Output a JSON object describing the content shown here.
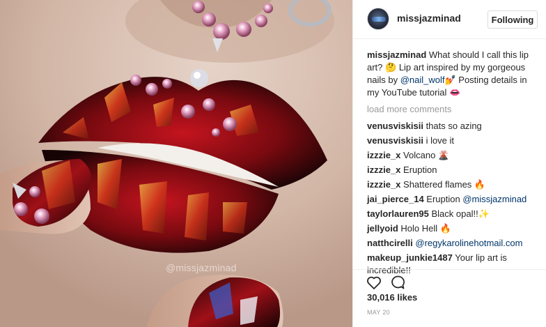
{
  "photo": {
    "watermark": "@missjazminad"
  },
  "header": {
    "username": "missjazminad",
    "follow_label": "Following"
  },
  "caption": {
    "username": "missjazminad",
    "text_1": " What should I call this lip art? ",
    "emoji_1": "🤔",
    "text_2": " Lip art inspired by my gorgeous nails by ",
    "mention": "@nail_wolf",
    "emoji_2": " 💅",
    "text_3": " Posting details in my YouTube tutorial ",
    "emoji_3": "👄"
  },
  "load_more": "load more comments",
  "comments": [
    {
      "user": "venusviskisii",
      "text": " thats so azing",
      "emoji": ""
    },
    {
      "user": "venusviskisii",
      "text": " i love it",
      "emoji": ""
    },
    {
      "user": "izzzie_x",
      "text": " Volcano ",
      "emoji": "🌋"
    },
    {
      "user": "izzzie_x",
      "text": " Eruption",
      "emoji": ""
    },
    {
      "user": "izzzie_x",
      "text": " Shattered flames ",
      "emoji": "🔥"
    },
    {
      "user": "jai_pierce_14",
      "text": " Eruption ",
      "mention": "@missjazminad"
    },
    {
      "user": "taylorlauren95",
      "text": " Black opal!!",
      "emoji": "✨"
    },
    {
      "user": "jellyoid",
      "text": " Holo Hell ",
      "emoji": "🔥"
    },
    {
      "user": "natthcirelli",
      "text": " ",
      "mention": "@regykarolinehotmail.com"
    },
    {
      "user": "makeup_junkie1487",
      "text": " Your lip art is incredible!!",
      "emoji": ""
    }
  ],
  "actions": {
    "like_icon": "heart-outline-icon",
    "comment_icon": "speech-bubble-icon",
    "likes": "30,016 likes",
    "date": "MAY 20"
  },
  "colors": {
    "link": "#003569",
    "muted": "#999999",
    "text": "#262626",
    "border": "#efefef"
  }
}
